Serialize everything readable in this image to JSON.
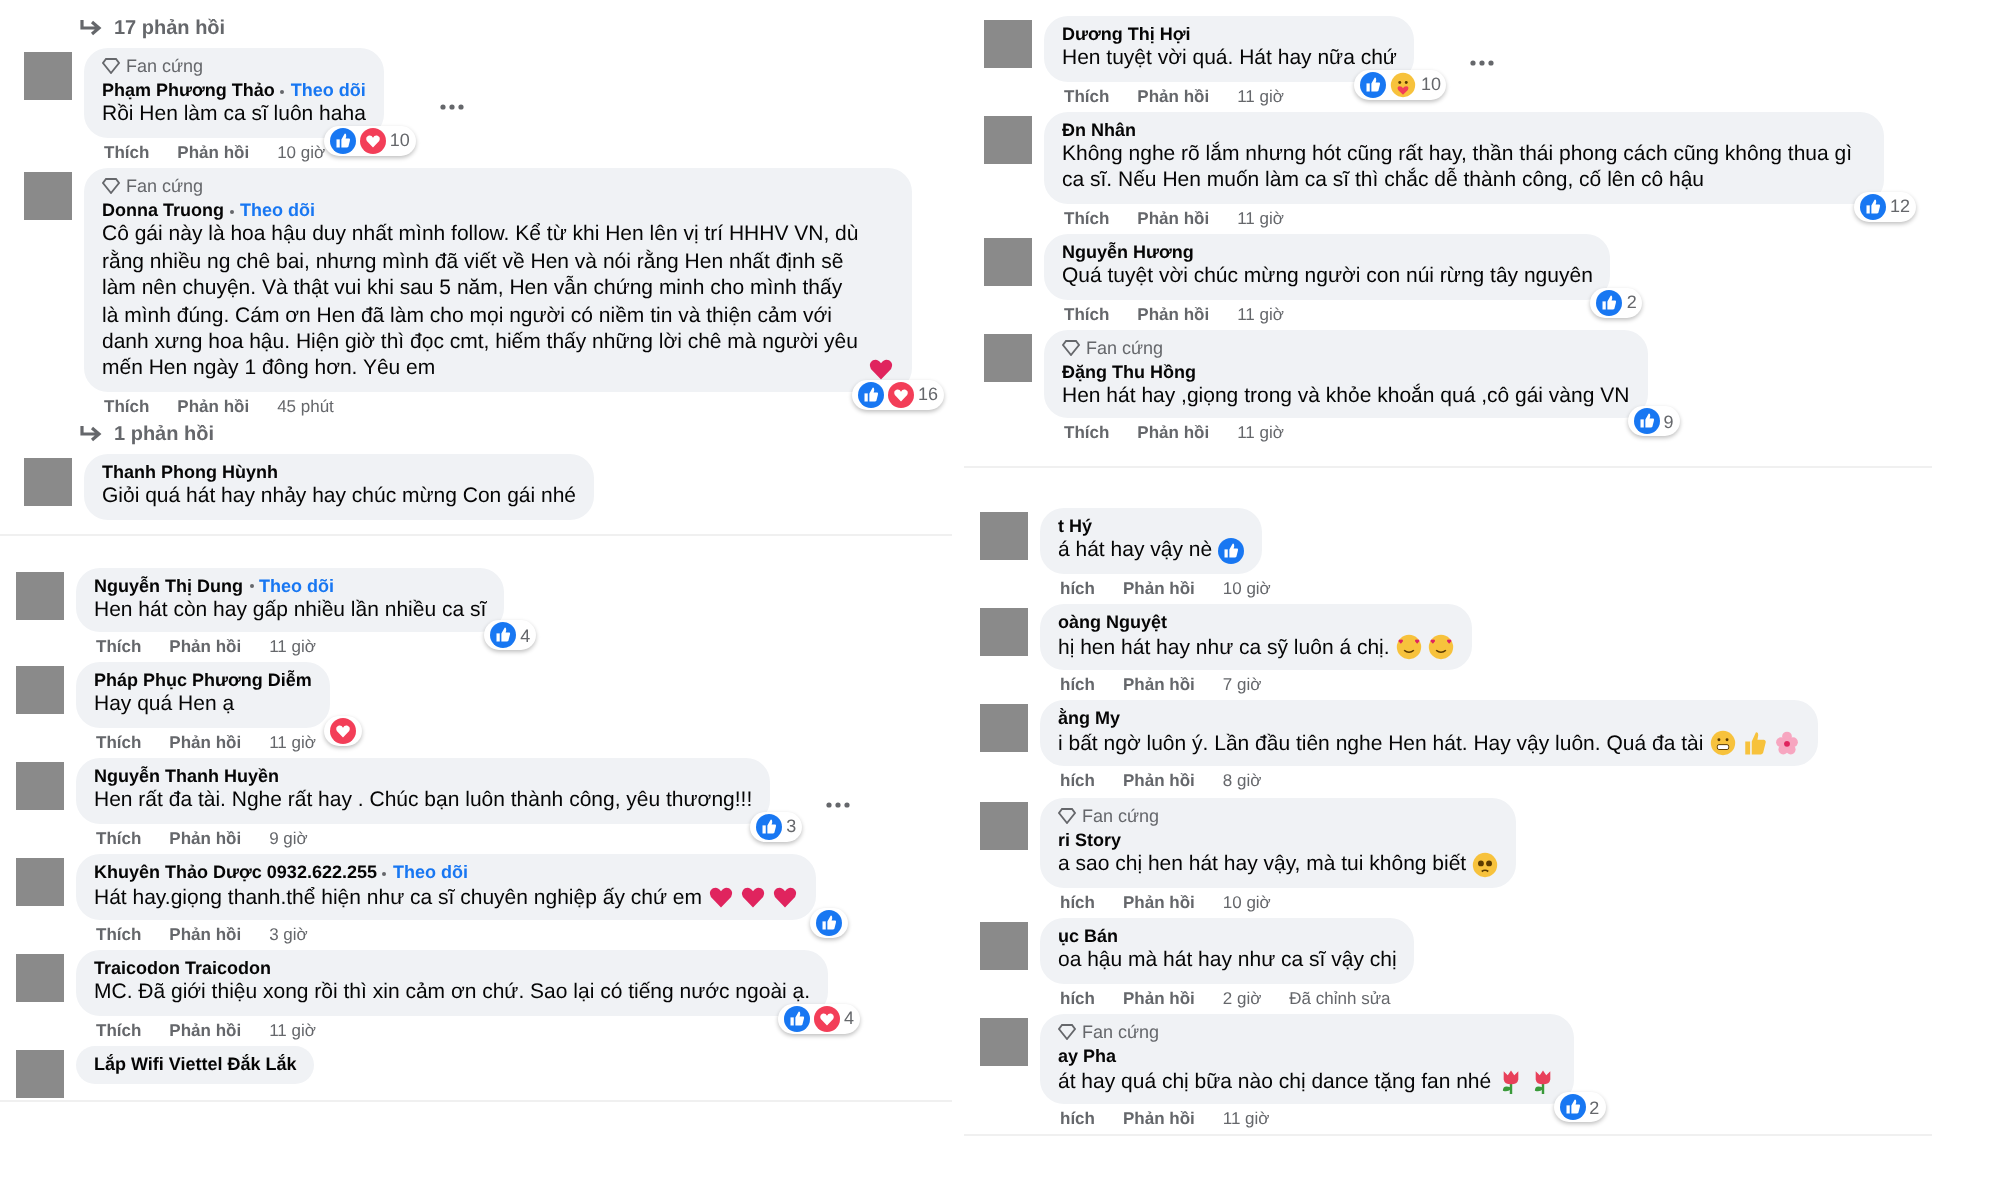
{
  "panels": [
    {
      "items": [
        {
          "kind": "replies",
          "label": "17 phản hồi"
        },
        {
          "kind": "comment",
          "badge": "Fan cứng",
          "name": "Phạm Phương Thảo",
          "follow": "Theo dõi",
          "text": "Rồi Hen làm ca sĩ luôn haha",
          "reactions": [
            {
              "kind": "like"
            },
            {
              "kind": "love"
            }
          ],
          "reaction_count": "10",
          "menu": true,
          "like": "Thích",
          "reply": "Phản hồi",
          "time": "10 giờ"
        },
        {
          "kind": "comment",
          "badge": "Fan cứng",
          "name": "Donna Truong",
          "follow": "Theo dõi",
          "text": "Cô gái này là hoa hậu duy nhất mình follow. Kể từ khi Hen lên vị trí HHHV VN, dù rằng nhiều ng chê bai, nhưng mình đã viết về Hen và nói rằng Hen nhất định sẽ làm nên chuyện. Và thật vui khi sau 5 năm, Hen vẫn chứng minh cho mình thấy là mình đúng. Cám ơn Hen đã làm cho mọi người có niềm tin và thiện cảm với danh xưng hoa hậu. Hiện giờ thì đọc cmt, hiếm thấy những lời chê mà người yêu mến Hen ngày 1 đông hơn. Yêu em",
          "emojis": [
            {
              "kind": "heart"
            }
          ],
          "reactions": [
            {
              "kind": "like"
            },
            {
              "kind": "love"
            }
          ],
          "reaction_count": "16",
          "like": "Thích",
          "reply": "Phản hồi",
          "time": "45 phút"
        },
        {
          "kind": "replies",
          "label": "1 phản hồi"
        },
        {
          "kind": "comment",
          "name": "Thanh Phong Hùynh",
          "text": "Giỏi quá hát hay nhảy hay chúc mừng Con gái nhé"
        }
      ]
    },
    {
      "items": [
        {
          "kind": "comment",
          "name": "Nguyễn Thị Dung",
          "follow": "Theo dõi",
          "text": "Hen hát còn hay gấp nhiều lần nhiều ca sĩ",
          "reactions": [
            {
              "kind": "like"
            }
          ],
          "reaction_count": "4",
          "like": "Thích",
          "reply": "Phản hồi",
          "time": "11 giờ"
        },
        {
          "kind": "comment",
          "name": "Pháp Phục Phương Diễm",
          "text": "Hay quá Hen ạ",
          "reactions": [
            {
              "kind": "love"
            }
          ],
          "like": "Thích",
          "reply": "Phản hồi",
          "time": "11 giờ"
        },
        {
          "kind": "comment",
          "name": "Nguyễn Thanh Huyền",
          "text": "Hen rất đa tài. Nghe rất hay . Chúc bạn luôn thành công, yêu thương!!!",
          "reactions": [
            {
              "kind": "like"
            }
          ],
          "reaction_count": "3",
          "menu": true,
          "like": "Thích",
          "reply": "Phản hồi",
          "time": "9 giờ"
        },
        {
          "kind": "comment",
          "name": "Khuyên Thảo Dược 0932.622.255",
          "follow": "Theo dõi",
          "text": "Hát hay.giọng thanh.thể hiện như ca sĩ chuyên nghiệp ấy chứ em",
          "emojis": [
            {
              "kind": "heart"
            },
            {
              "kind": "heart"
            },
            {
              "kind": "heart"
            }
          ],
          "reactions": [
            {
              "kind": "like"
            }
          ],
          "like": "Thích",
          "reply": "Phản hồi",
          "time": "3 giờ"
        },
        {
          "kind": "comment",
          "name": "Traicodon Traicodon",
          "text": "MC. Đã giới thiệu xong rồi thì xin cảm ơn chứ. Sao lại có tiếng nước ngoài ạ.",
          "reactions": [
            {
              "kind": "like"
            },
            {
              "kind": "love"
            }
          ],
          "reaction_count": "4",
          "like": "Thích",
          "reply": "Phản hồi",
          "time": "11 giờ"
        },
        {
          "kind": "comment",
          "name": "Lắp Wifi Viettel Đắk Lắk"
        }
      ]
    },
    {
      "items": [
        {
          "kind": "comment",
          "name": "Dương Thị Hợi",
          "text": "Hen tuyệt vời quá. Hát hay nữa chứ",
          "reactions": [
            {
              "kind": "like"
            },
            {
              "kind": "care"
            }
          ],
          "reaction_count": "10",
          "menu": true,
          "like": "Thích",
          "reply": "Phản hồi",
          "time": "11 giờ"
        },
        {
          "kind": "comment",
          "name": "Đn Nhân",
          "text": "Không nghe rõ lắm nhưng hót cũng rất hay, thần thái phong cách cũng không thua gì ca sĩ. Nếu Hen muốn làm ca sĩ thì chắc dễ thành công, cố lên cô hậu",
          "reactions": [
            {
              "kind": "like"
            }
          ],
          "reaction_count": "12",
          "like": "Thích",
          "reply": "Phản hồi",
          "time": "11 giờ"
        },
        {
          "kind": "comment",
          "name": "Nguyễn Hương",
          "text": "Quá tuyệt vời chúc mừng người con núi rừng tây nguyên",
          "reactions": [
            {
              "kind": "like"
            }
          ],
          "reaction_count": "2",
          "like": "Thích",
          "reply": "Phản hồi",
          "time": "11 giờ"
        },
        {
          "kind": "comment",
          "badge": "Fan cứng",
          "name": "Đặng Thu Hồng",
          "text": "Hen hát hay ,giọng trong và khỏe khoắn quá ,cô gái vàng VN",
          "reactions": [
            {
              "kind": "like"
            }
          ],
          "reaction_count": "9",
          "like": "Thích",
          "reply": "Phản hồi",
          "time": "11 giờ"
        }
      ]
    },
    {
      "items": [
        {
          "kind": "comment",
          "name": "t Hý",
          "text": "á hát hay vậy nè",
          "emojis": [
            {
              "kind": "like"
            }
          ],
          "like": "hích",
          "reply": "Phản hồi",
          "time": "10 giờ"
        },
        {
          "kind": "comment",
          "name": "oàng Nguyệt",
          "text": "hị hen hát hay như ca sỹ luôn á chị.",
          "emojis": [
            {
              "kind": "smile-hearts"
            },
            {
              "kind": "smile-hearts"
            }
          ],
          "like": "hích",
          "reply": "Phản hồi",
          "time": "7 giờ"
        },
        {
          "kind": "comment",
          "name": "ằng My",
          "text": "i bất ngờ luôn ý. Lần đầu tiên nghe Hen hát. Hay vậy luôn. Quá đa tài",
          "emojis": [
            {
              "kind": "grimace"
            },
            {
              "kind": "thumbs-up"
            },
            {
              "kind": "blossom"
            }
          ],
          "like": "hích",
          "reply": "Phản hồi",
          "time": "8 giờ"
        },
        {
          "kind": "comment",
          "badge": "Fan cứng",
          "name": "ri Story",
          "text": "a sao chị hen hát hay vậy, mà tui không biết",
          "emojis": [
            {
              "kind": "pleading"
            }
          ],
          "like": "hích",
          "reply": "Phản hồi",
          "time": "10 giờ"
        },
        {
          "kind": "comment",
          "name": "ục Bán",
          "text": "oa hậu mà hát hay như ca sĩ vậy chị",
          "like": "hích",
          "reply": "Phản hồi",
          "time": "2 giờ",
          "edited": "Đã chỉnh sửa"
        },
        {
          "kind": "comment",
          "badge": "Fan cứng",
          "name": "ay Pha",
          "text": "át hay quá chị bữa nào chị dance tặng fan nhé",
          "emojis": [
            {
              "kind": "tulip"
            },
            {
              "kind": "tulip"
            }
          ],
          "reactions": [
            {
              "kind": "like"
            }
          ],
          "reaction_count": "2",
          "like": "hích",
          "reply": "Phản hồi",
          "time": "11 giờ"
        }
      ]
    }
  ]
}
